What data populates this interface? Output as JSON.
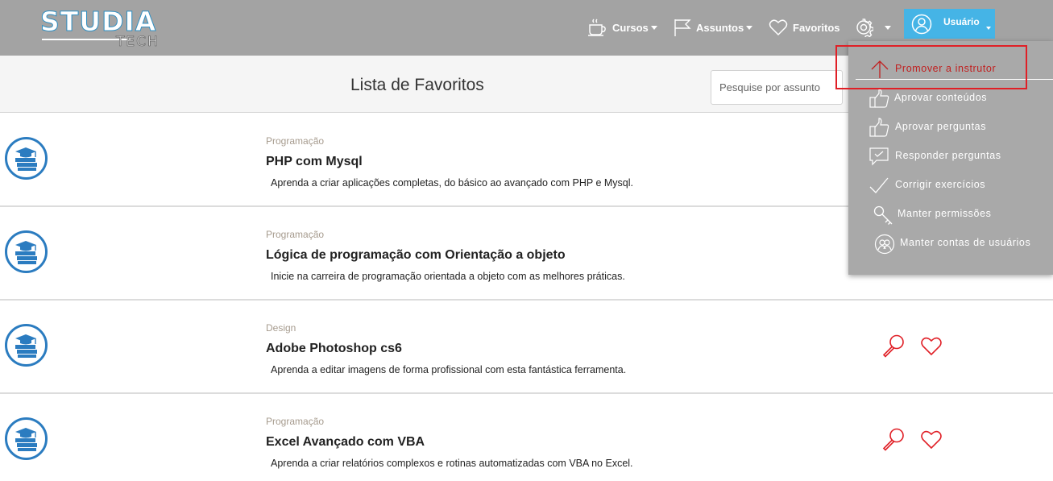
{
  "brand": {
    "logo_main": "STUDIA",
    "logo_sub": "TECH"
  },
  "nav": {
    "cursos": "Cursos",
    "assuntos": "Assuntos",
    "favoritos": "Favoritos",
    "user": "Usuário"
  },
  "page": {
    "title": "Lista de Favoritos",
    "search_placeholder": "Pesquise por assunto"
  },
  "courses": [
    {
      "category": "Programação",
      "title": "PHP com Mysql",
      "description": "Aprenda a criar aplicações completas, do básico ao avançado com PHP e Mysql."
    },
    {
      "category": "Programação",
      "title": "Lógica de programação com Orientação a objeto",
      "description": "Inicie na carreira de programação orientada a objeto com as melhores práticas."
    },
    {
      "category": "Design",
      "title": "Adobe Photoshop cs6",
      "description": "Aprenda a editar imagens de forma profissional com esta fantástica ferramenta."
    },
    {
      "category": "Programação",
      "title": "Excel Avançado com VBA",
      "description": "Aprenda a criar relatórios complexos e rotinas automatizadas com VBA no Excel."
    }
  ],
  "user_menu": {
    "items": [
      {
        "label": "Promover a instrutor",
        "icon": "arrow-up-icon"
      },
      {
        "label": "Aprovar conteúdos",
        "icon": "thumbs-up-icon"
      },
      {
        "label": "Aprovar perguntas",
        "icon": "thumbs-up-icon"
      },
      {
        "label": "Responder perguntas",
        "icon": "chat-check-icon"
      },
      {
        "label": "Corrigir exercícios",
        "icon": "check-icon"
      },
      {
        "label": "Manter permissões",
        "icon": "key-icon"
      },
      {
        "label": "Manter contas de usuários",
        "icon": "users-icon"
      }
    ]
  },
  "colors": {
    "navbar": "#a3a3a3",
    "user_button": "#45b4e6",
    "accent_red": "#e01f26",
    "icon_blue": "#2b7cc0",
    "category_text": "#a69b8e"
  }
}
